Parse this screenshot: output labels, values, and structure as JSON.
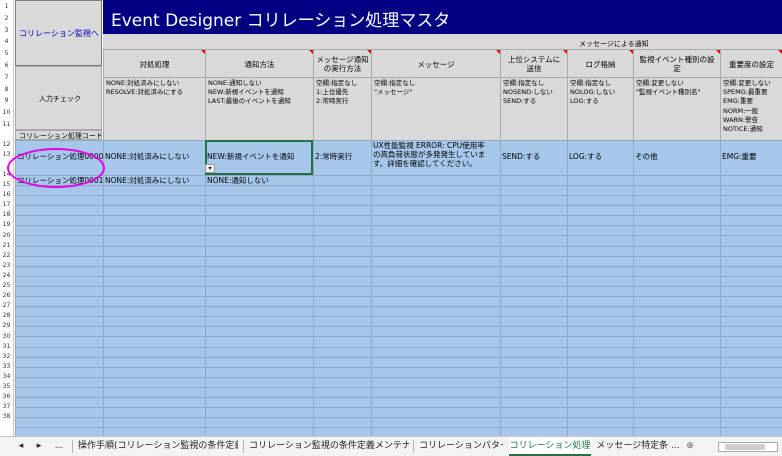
{
  "sheet": {
    "link_button": "コリレーション監視へ",
    "title": "Event Designer コリレーション処理マスタ",
    "group_header": "メッセージによる通知",
    "input_check_label": "入力チェック",
    "code_header": "コリレーション処理コード",
    "columns": [
      {
        "header": "対処処理",
        "desc": [
          "NONE:対処済みにしない",
          "RESOLVE:対処済みにする"
        ]
      },
      {
        "header": "通知方法",
        "desc": [
          "NONE:通知しない",
          "NEW:新規イベントを通知",
          "LAST:最後のイベントを通知"
        ]
      },
      {
        "header": [
          "メッセージ通知",
          "の実行方法"
        ],
        "desc": [
          "空欄:指定なし",
          "1:上位優先",
          "2:常時実行"
        ]
      },
      {
        "header": "メッセージ",
        "desc": [
          "空欄:指定なし",
          "\"メッセージ\""
        ]
      },
      {
        "header": [
          "上位システムに",
          "送信"
        ],
        "desc": [
          "空欄:指定なし",
          "NOSEND:しない",
          "SEND:する"
        ]
      },
      {
        "header": "ログ格納",
        "desc": [
          "空欄:指定なし",
          "NOLOG:しない",
          "LOG:する"
        ]
      },
      {
        "header": [
          "監視イベント種別の設",
          "定"
        ],
        "desc": [
          "空欄:変更しない",
          "\"監視イベント種別名\""
        ]
      },
      {
        "header": "重要度の設定",
        "desc": [
          "空欄:変更しない",
          "SPEMG:最重要",
          "EMG:重要",
          "NORM:一般",
          "WARN:警告",
          "NOTICE:通知"
        ]
      }
    ],
    "rows": [
      {
        "code": "コリレーション処理0000",
        "cells": [
          "NONE:対処済みにしない",
          "NEW:新規イベントを通知",
          "2:常時実行",
          [
            "UX性能監視 ERROR: CPU使用率",
            "の高負荷状態が多発発生していま",
            "す。詳細を確認してください。"
          ],
          "SEND:する",
          "LOG:する",
          "その他",
          "EMG:重要"
        ]
      },
      {
        "code": "コリレーション処理0001",
        "cells": [
          "NONE:対処済みにしない",
          "NONE:通知しない",
          "",
          "",
          "",
          "",
          "",
          ""
        ]
      }
    ],
    "row_numbers": [
      "1",
      "2",
      "3",
      "4",
      "5",
      "6",
      "7",
      "8",
      "9",
      "10",
      "11",
      "12",
      "13",
      "14",
      "15",
      "16",
      "17",
      "18",
      "19",
      "20",
      "21",
      "22",
      "23",
      "24",
      "25",
      "26",
      "27",
      "28",
      "29",
      "30",
      "31",
      "32",
      "33",
      "34",
      "35",
      "36",
      "37",
      "38"
    ]
  },
  "tabs": {
    "nav_prev": "◂",
    "nav_next": "▸",
    "ellipsis": "...",
    "items": [
      "操作手順(コリレーション監視の条件定義)",
      "コリレーション監視の条件定義メンテナンス",
      "コリレーションパターン",
      "コリレーション処理",
      "メッセージ特定条 ..."
    ],
    "active_index": 3,
    "add": "⊕"
  },
  "colors": {
    "title_bg": "#000080",
    "header_bg": "#d9d9d9",
    "data_bg": "#a7c7ea",
    "highlight": "#e600e6",
    "accent": "#217346"
  }
}
